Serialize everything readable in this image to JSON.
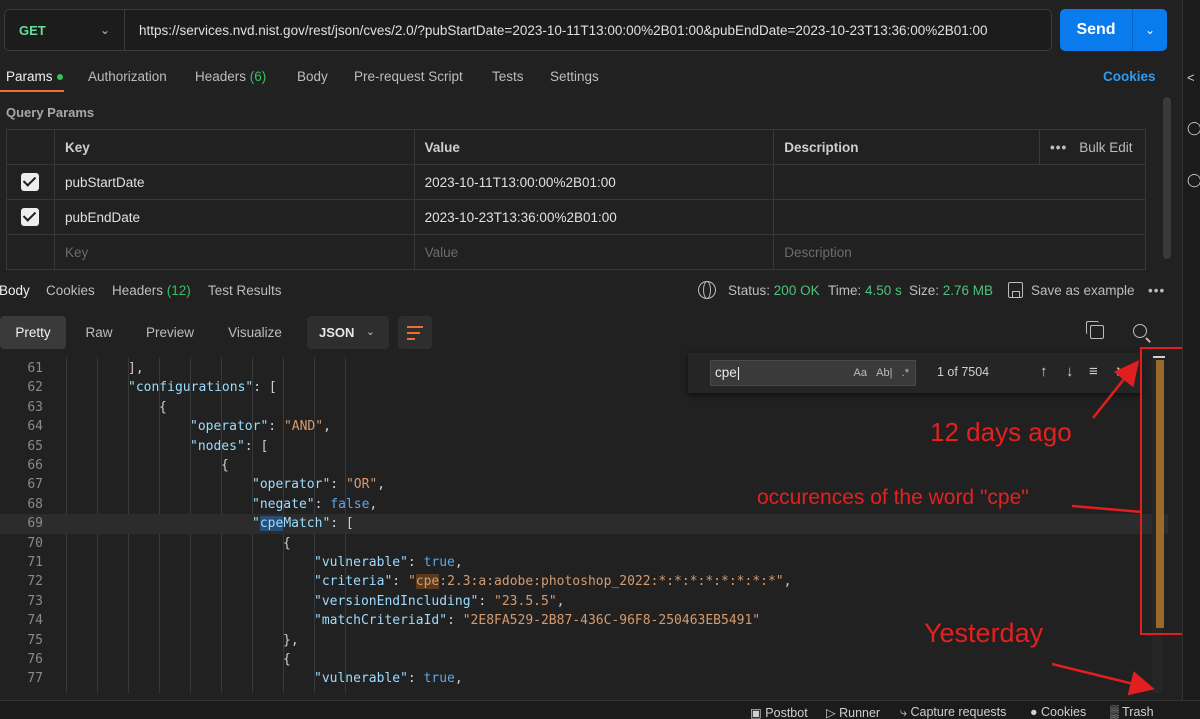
{
  "request": {
    "method": "GET",
    "url": "https://services.nvd.nist.gov/rest/json/cves/2.0/?pubStartDate=2023-10-11T13:00:00%2B01:00&pubEndDate=2023-10-23T13:36:00%2B01:00",
    "send_label": "Send"
  },
  "request_tabs": {
    "params": "Params",
    "authorization": "Authorization",
    "headers": "Headers",
    "headers_count": "(6)",
    "body": "Body",
    "prerequest": "Pre-request Script",
    "tests": "Tests",
    "settings": "Settings",
    "cookies": "Cookies"
  },
  "query_params": {
    "title": "Query Params",
    "columns": {
      "key": "Key",
      "value": "Value",
      "description": "Description",
      "bulk_edit": "Bulk Edit"
    },
    "rows": [
      {
        "key": "pubStartDate",
        "value": "2023-10-11T13:00:00%2B01:00",
        "description": ""
      },
      {
        "key": "pubEndDate",
        "value": "2023-10-23T13:36:00%2B01:00",
        "description": ""
      }
    ],
    "placeholder": {
      "key": "Key",
      "value": "Value",
      "description": "Description"
    }
  },
  "response_tabs": {
    "body": "Body",
    "cookies": "Cookies",
    "headers": "Headers",
    "headers_count": "(12)",
    "test_results": "Test Results"
  },
  "response_meta": {
    "status_label": "Status:",
    "status_value": "200 OK",
    "time_label": "Time:",
    "time_value": "4.50 s",
    "size_label": "Size:",
    "size_value": "2.76 MB",
    "save_example": "Save as example"
  },
  "view_modes": [
    "Pretty",
    "Raw",
    "Preview",
    "Visualize"
  ],
  "active_view": "Pretty",
  "format": "JSON",
  "find": {
    "query": "cpe",
    "count": "1 of 7504",
    "opt_case": "Aa",
    "opt_word": "Ab|",
    "opt_regex": ".*"
  },
  "code_lines": [
    {
      "n": "61",
      "indent": 4,
      "tokens": [
        [
          "p",
          "],"
        ]
      ]
    },
    {
      "n": "62",
      "indent": 4,
      "tokens": [
        [
          "k",
          "\"configurations\""
        ],
        [
          "p",
          ": ["
        ]
      ]
    },
    {
      "n": "63",
      "indent": 5,
      "tokens": [
        [
          "p",
          "{"
        ]
      ]
    },
    {
      "n": "64",
      "indent": 6,
      "tokens": [
        [
          "k",
          "\"operator\""
        ],
        [
          "p",
          ": "
        ],
        [
          "s",
          "\"AND\""
        ],
        [
          "p",
          ","
        ]
      ]
    },
    {
      "n": "65",
      "indent": 6,
      "tokens": [
        [
          "k",
          "\"nodes\""
        ],
        [
          "p",
          ": ["
        ]
      ]
    },
    {
      "n": "66",
      "indent": 7,
      "tokens": [
        [
          "p",
          "{"
        ]
      ]
    },
    {
      "n": "67",
      "indent": 8,
      "tokens": [
        [
          "k",
          "\"operator\""
        ],
        [
          "p",
          ": "
        ],
        [
          "s",
          "\"OR\""
        ],
        [
          "p",
          ","
        ]
      ]
    },
    {
      "n": "68",
      "indent": 8,
      "tokens": [
        [
          "k",
          "\"negate\""
        ],
        [
          "p",
          ": "
        ],
        [
          "b",
          "false"
        ],
        [
          "p",
          ","
        ]
      ]
    },
    {
      "n": "69",
      "indent": 8,
      "tokens": [
        [
          "k",
          "\""
        ],
        [
          "ksel",
          "cpe"
        ],
        [
          "k",
          "Match\""
        ],
        [
          "p",
          ": ["
        ]
      ],
      "hl": true
    },
    {
      "n": "70",
      "indent": 9,
      "tokens": [
        [
          "p",
          "{"
        ]
      ]
    },
    {
      "n": "71",
      "indent": 10,
      "tokens": [
        [
          "k",
          "\"vulnerable\""
        ],
        [
          "p",
          ": "
        ],
        [
          "b",
          "true"
        ],
        [
          "p",
          ","
        ]
      ]
    },
    {
      "n": "72",
      "indent": 10,
      "tokens": [
        [
          "k",
          "\"criteria\""
        ],
        [
          "p",
          ": "
        ],
        [
          "s",
          "\""
        ],
        [
          "smark",
          "cpe"
        ],
        [
          "s",
          ":2.3:a:adobe:photoshop_2022:*:*:*:*:*:*:*:*\""
        ],
        [
          "p",
          ","
        ]
      ]
    },
    {
      "n": "73",
      "indent": 10,
      "tokens": [
        [
          "k",
          "\"versionEndIncluding\""
        ],
        [
          "p",
          ": "
        ],
        [
          "s",
          "\"23.5.5\""
        ],
        [
          "p",
          ","
        ]
      ]
    },
    {
      "n": "74",
      "indent": 10,
      "tokens": [
        [
          "k",
          "\"matchCriteriaId\""
        ],
        [
          "p",
          ": "
        ],
        [
          "s",
          "\"2E8FA529-2B87-436C-96F8-250463EB5491\""
        ]
      ]
    },
    {
      "n": "75",
      "indent": 9,
      "tokens": [
        [
          "p",
          "},"
        ]
      ]
    },
    {
      "n": "76",
      "indent": 9,
      "tokens": [
        [
          "p",
          "{"
        ]
      ]
    },
    {
      "n": "77",
      "indent": 10,
      "tokens": [
        [
          "k",
          "\"vulnerable\""
        ],
        [
          "p",
          ": "
        ],
        [
          "b",
          "true"
        ],
        [
          "p",
          ","
        ]
      ]
    }
  ],
  "annotations": {
    "days_ago": "12 days ago",
    "occurrences": "occurences of the word \"cpe\"",
    "yesterday": "Yesterday",
    "color": "#e21f1f"
  },
  "statusbar": {
    "postbot": "Postbot",
    "runner": "Runner",
    "capture": "Capture requests",
    "cookies": "Cookies",
    "trash": "Trash"
  },
  "colors": {
    "accent_orange": "#f26b3a",
    "send_blue": "#097bed",
    "status_green": "#4ec27a",
    "occurrence_bar": "#9a6a2b"
  }
}
